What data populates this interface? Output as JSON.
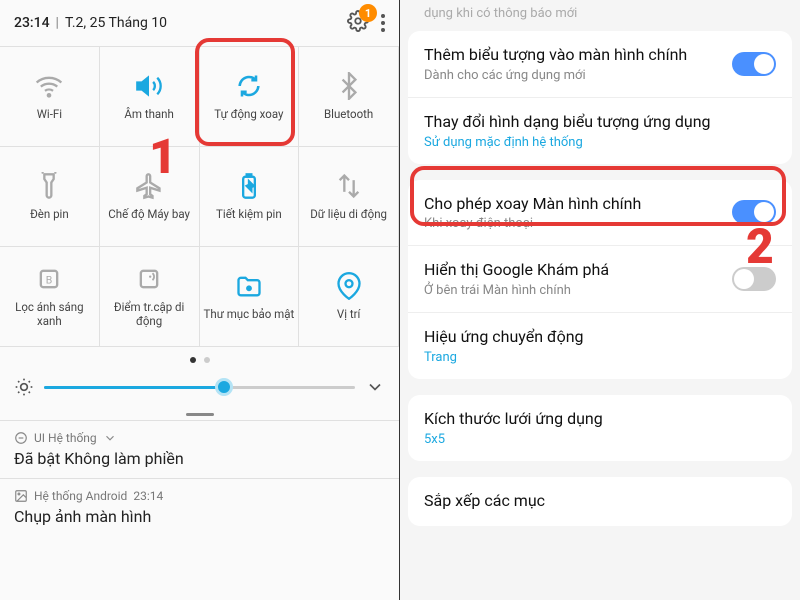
{
  "status": {
    "time": "23:14",
    "date": "T.2, 25 Tháng 10",
    "badge": "1"
  },
  "tiles": [
    {
      "label": "Wi-Fi"
    },
    {
      "label": "Âm thanh"
    },
    {
      "label": "Tự động xoay"
    },
    {
      "label": "Bluetooth"
    },
    {
      "label": "Đèn pin"
    },
    {
      "label": "Chế độ Máy bay"
    },
    {
      "label": "Tiết kiệm pin"
    },
    {
      "label": "Dữ liệu di động"
    },
    {
      "label": "Lọc ánh sáng xanh"
    },
    {
      "label": "Điểm tr.cập di động"
    },
    {
      "label": "Thư mục bảo mật"
    },
    {
      "label": "Vị trí"
    }
  ],
  "steps": {
    "s1": "1",
    "s2": "2"
  },
  "notif1": {
    "app": "UI Hệ thống",
    "title": "Đã bật Không làm phiền"
  },
  "notif2": {
    "app": "Hệ thống Android",
    "time": "23:14",
    "title": "Chụp ảnh màn hình"
  },
  "settings": {
    "partial": "dụng khi có thông báo mới",
    "s1": {
      "title": "Thêm biểu tượng vào màn hình chính",
      "sub": "Dành cho các ứng dụng mới"
    },
    "s2": {
      "title": "Thay đổi hình dạng biểu tượng ứng dụng",
      "sub": "Sử dụng mặc định hệ thống"
    },
    "s3": {
      "title": "Cho phép xoay Màn hình chính",
      "sub": "Khi xoay điện thoại"
    },
    "s4": {
      "title": "Hiển thị Google Khám phá",
      "sub": "Ở bên trái Màn hình chính"
    },
    "s5": {
      "title": "Hiệu ứng chuyển động",
      "sub": "Trang"
    },
    "s6": {
      "title": "Kích thước lưới ứng dụng",
      "sub": "5x5"
    },
    "s7": {
      "title": "Sắp xếp các mục"
    }
  }
}
